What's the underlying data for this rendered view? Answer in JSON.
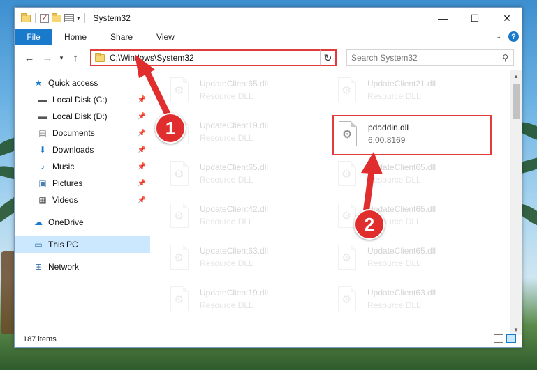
{
  "window": {
    "title": "System32"
  },
  "ribbon": {
    "tabs": [
      "File",
      "Home",
      "Share",
      "View"
    ]
  },
  "address": {
    "path": "C:\\Windows\\System32"
  },
  "search": {
    "placeholder": "Search System32"
  },
  "sidebar": {
    "items": [
      {
        "label": "Quick access",
        "icon": "star-icon",
        "pinned": false,
        "selected": false
      },
      {
        "label": "Local Disk (C:)",
        "icon": "drive-icon",
        "pinned": true,
        "selected": false
      },
      {
        "label": "Local Disk (D:)",
        "icon": "drive-icon",
        "pinned": true,
        "selected": false
      },
      {
        "label": "Documents",
        "icon": "documents-icon",
        "pinned": true,
        "selected": false
      },
      {
        "label": "Downloads",
        "icon": "download-icon",
        "pinned": true,
        "selected": false
      },
      {
        "label": "Music",
        "icon": "music-icon",
        "pinned": true,
        "selected": false
      },
      {
        "label": "Pictures",
        "icon": "pictures-icon",
        "pinned": true,
        "selected": false
      },
      {
        "label": "Videos",
        "icon": "videos-icon",
        "pinned": true,
        "selected": false
      },
      {
        "label": "OneDrive",
        "icon": "cloud-icon",
        "pinned": false,
        "selected": false
      },
      {
        "label": "This PC",
        "icon": "computer-icon",
        "pinned": false,
        "selected": true
      },
      {
        "label": "Network",
        "icon": "network-icon",
        "pinned": false,
        "selected": false
      }
    ]
  },
  "files": {
    "col1": [
      {
        "name": "UpdateClient65.dll",
        "desc": "Resource DLL"
      },
      {
        "name": "UpdateClient19.dll",
        "desc": "Resource DLL"
      },
      {
        "name": "UpdateClient65.dll",
        "desc": "Resource DLL"
      },
      {
        "name": "UpdateClient42.dll",
        "desc": "Resource DLL"
      },
      {
        "name": "UpdateClient63.dll",
        "desc": "Resource DLL"
      },
      {
        "name": "UpdateClient19.dll",
        "desc": "Resource DLL"
      }
    ],
    "col2": [
      {
        "name": "UpdateClient21.dll",
        "desc": "Resource DLL"
      },
      {
        "name": "pdaddin.dll",
        "desc": "6.00.8169",
        "highlighted": true
      },
      {
        "name": "UpdateClient65.dll",
        "desc": "Resource DLL"
      },
      {
        "name": "UpdateClient65.dll",
        "desc": "Resource DLL"
      },
      {
        "name": "UpdateClient65.dll",
        "desc": "Resource DLL"
      },
      {
        "name": "UpdateClient63.dll",
        "desc": "Resource DLL"
      }
    ]
  },
  "status": {
    "items_count": "187 items"
  },
  "callouts": {
    "one": "1",
    "two": "2"
  },
  "colors": {
    "accent": "#1979ca",
    "highlight": "#e03c3c",
    "selection": "#cce8ff"
  }
}
